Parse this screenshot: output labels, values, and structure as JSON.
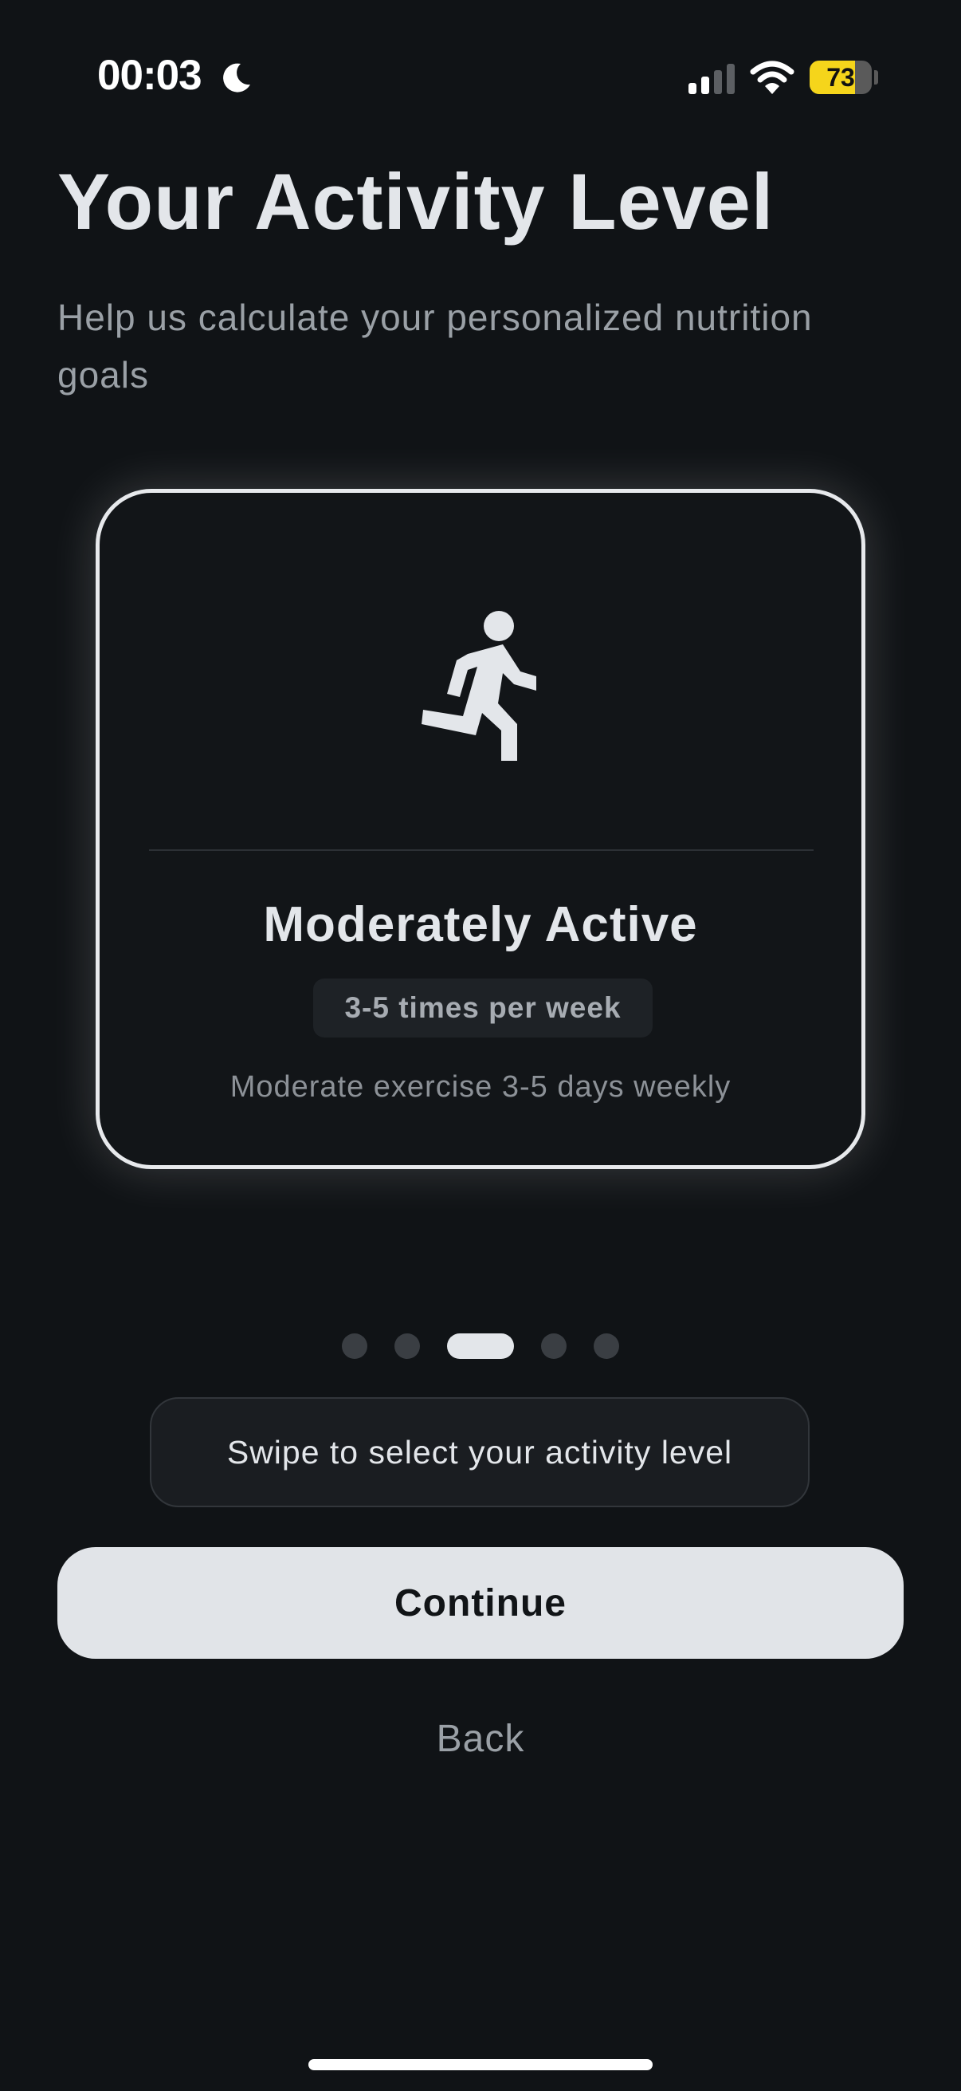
{
  "status_bar": {
    "time": "00:03",
    "battery_level": "73",
    "battery_fraction": 0.73,
    "icons": [
      "moon-icon",
      "signal-icon",
      "wifi-icon",
      "battery-icon"
    ]
  },
  "header": {
    "title": "Your Activity Level",
    "subtitle": "Help us calculate your personalized nutrition goals"
  },
  "card": {
    "icon": "running-person-icon",
    "title": "Moderately Active",
    "frequency": "3-5 times per week",
    "description": "Moderate exercise 3-5 days weekly"
  },
  "pager": {
    "count": 5,
    "active_index": 2
  },
  "hint": {
    "text": "Swipe to select your activity level"
  },
  "actions": {
    "continue_label": "Continue",
    "back_label": "Back"
  },
  "colors": {
    "background": "#101316",
    "primary_text": "#e3e6ea",
    "secondary_text": "#9aa0a6",
    "battery": "#f5d51b",
    "card_border": "#e7e9ec"
  }
}
